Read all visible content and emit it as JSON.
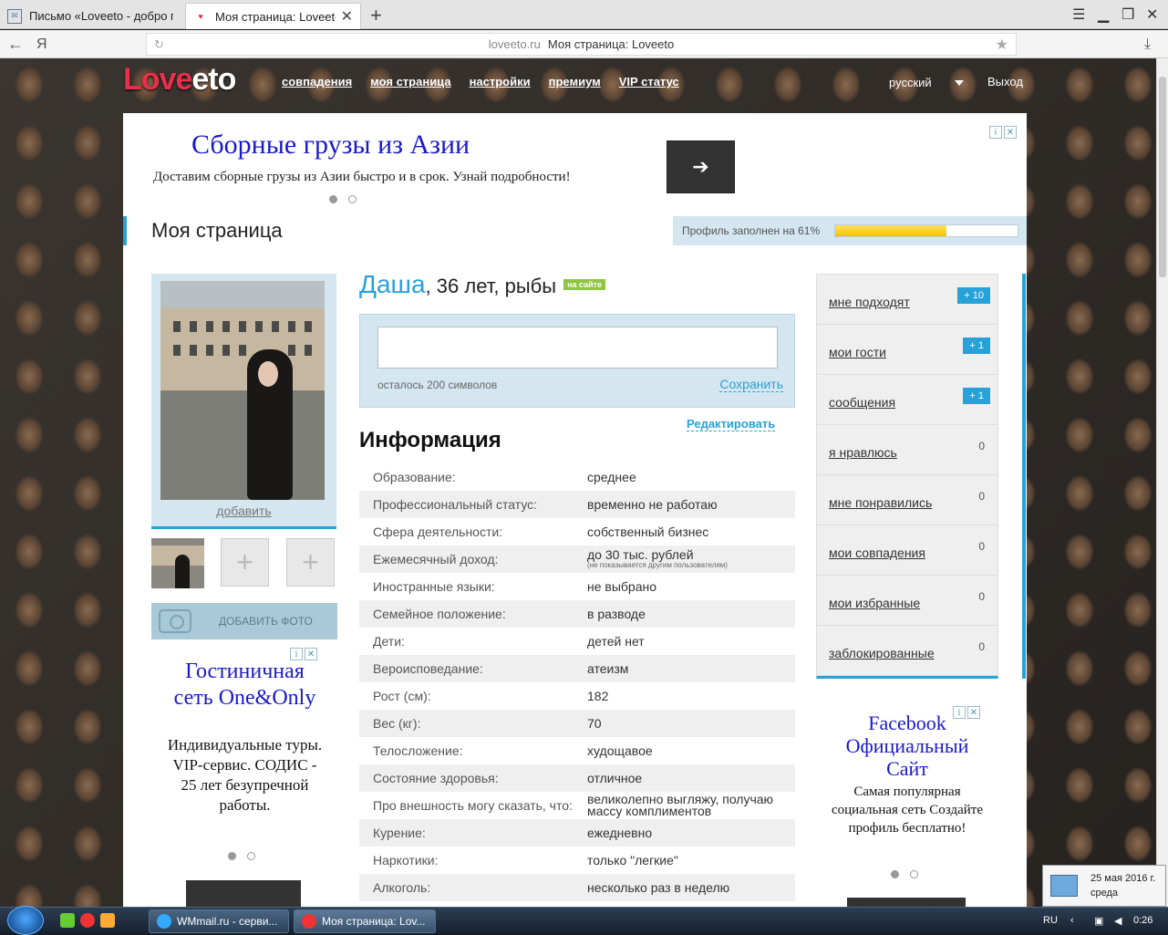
{
  "browser": {
    "tabs": [
      {
        "title": "Письмо «Loveeto - добро по"
      },
      {
        "title": "Моя страница: Loveeto"
      }
    ],
    "url_domain": "loveeto.ru",
    "url_title": "Моя страница: Loveeto",
    "yandex_glyph": "Я"
  },
  "header": {
    "logo_love": "Love",
    "logo_eto": "eto",
    "nav": [
      "совпадения",
      "моя страница",
      "настройки",
      "премиум",
      "VIP статус"
    ],
    "language": "русский",
    "logout": "Выход"
  },
  "ad_top": {
    "headline": "Сборные грузы из Азии",
    "text": "Доставим сборные грузы из Азии быстро и в срок. Узнай подробности!",
    "arrow": "➔"
  },
  "page_title": "Моя страница",
  "profile_progress": {
    "label": "Профиль заполнен на 61%",
    "percent": 61
  },
  "photo": {
    "add_link": "добавить",
    "add_photo_button": "ДОБАВИТЬ ФОТО",
    "placeholder_plus": "+"
  },
  "profile": {
    "name": "Даша",
    "details": ", 36 лет, рыбы",
    "online_badge": "на сайте",
    "status_remaining": "осталось 200 символов",
    "save": "Сохранить",
    "edit": "Редактировать",
    "info_heading": "Информация",
    "info": [
      {
        "k": "Образование:",
        "v": "среднее"
      },
      {
        "k": "Профессиональный статус:",
        "v": "временно не работаю"
      },
      {
        "k": "Сфера деятельности:",
        "v": "собственный бизнес"
      },
      {
        "k": "Ежемесячный доход:",
        "v": "до 30 тыс. рублей",
        "note": "(не показывается другим пользователям)"
      },
      {
        "k": "Иностранные языки:",
        "v": "не выбрано"
      },
      {
        "k": "Семейное положение:",
        "v": "в разводе"
      },
      {
        "k": "Дети:",
        "v": "детей нет"
      },
      {
        "k": "Вероисповедание:",
        "v": "атеизм"
      },
      {
        "k": "Рост (см):",
        "v": "182"
      },
      {
        "k": "Вес (кг):",
        "v": "70"
      },
      {
        "k": "Телосложение:",
        "v": "худощавое"
      },
      {
        "k": "Состояние здоровья:",
        "v": "отличное"
      },
      {
        "k": "Про внешность могу сказать, что:",
        "v": "великолепно выгляжу, получаю массу комплиментов"
      },
      {
        "k": "Курение:",
        "v": "ежедневно"
      },
      {
        "k": "Наркотики:",
        "v": "только \"легкие\""
      },
      {
        "k": "Алкоголь:",
        "v": "несколько раз в неделю"
      }
    ]
  },
  "side_menu": [
    {
      "label": "мне подходят",
      "badge": "+ 10"
    },
    {
      "label": "мои гости",
      "badge": "+ 1"
    },
    {
      "label": "сообщения",
      "badge": "+ 1"
    },
    {
      "label": "я нравлюсь",
      "count": "0"
    },
    {
      "label": "мне понравились",
      "count": "0"
    },
    {
      "label": "мои совпадения",
      "count": "0"
    },
    {
      "label": "мои избранные",
      "count": "0"
    },
    {
      "label": "заблокированные",
      "count": "0"
    }
  ],
  "ad_left": {
    "headline": "Гостиничная сеть One&Only",
    "text": "Индивидуальные туры. VIP-сервис. СОДИС - 25 лет безупречной работы."
  },
  "ad_right": {
    "headline": "Facebook Официальный Сайт",
    "text": "Самая популярная социальная сеть Создайте профиль бесплатно!"
  },
  "taskbar": {
    "items": [
      {
        "label": "WMmail.ru - серви..."
      },
      {
        "label": "Моя страница: Lov..."
      }
    ],
    "lang": "RU",
    "time": "0:26",
    "date": "25 мая 2016 г.",
    "weekday": "среда"
  },
  "colors": {
    "accent": "#27a2d8",
    "logo": "#e8304a",
    "ad_link": "#1a1acc",
    "online": "#8dc63f"
  }
}
